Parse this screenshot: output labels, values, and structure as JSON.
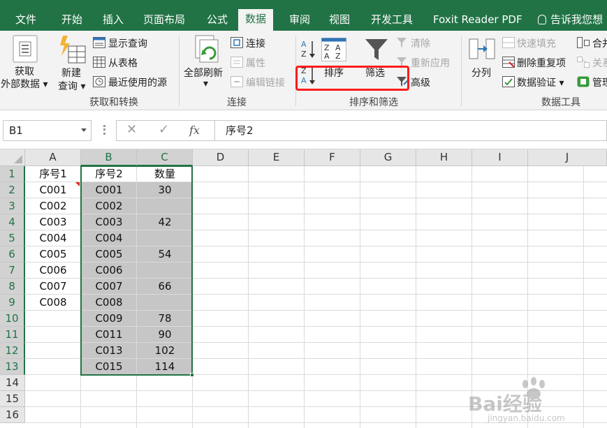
{
  "ribbon_tabs": [
    "文件",
    "开始",
    "插入",
    "页面布局",
    "公式",
    "数据",
    "审阅",
    "视图",
    "开发工具",
    "Foxit Reader PDF"
  ],
  "active_tab": "数据",
  "tell_me": "告诉我您想",
  "groups": {
    "get_transform": {
      "label": "获取和转换",
      "get_external_line1": "获取",
      "get_external_line2": "外部数据",
      "new_query_line1": "新建",
      "new_query_line2": "查询",
      "show_queries": "显示查询",
      "from_table": "从表格",
      "recent_sources": "最近使用的源"
    },
    "connections": {
      "label": "连接",
      "refresh_all": "全部刷新",
      "connections": "连接",
      "properties": "属性",
      "edit_links": "编辑链接"
    },
    "sort_filter": {
      "label": "排序和筛选",
      "sort": "排序",
      "filter": "筛选",
      "clear": "清除",
      "reapply": "重新应用",
      "advanced": "高级"
    },
    "data_tools": {
      "label": "数据工具",
      "text_to_columns": "分列",
      "flash_fill": "快速填充",
      "remove_duplicates": "删除重复项",
      "data_validation": "数据验证",
      "consolidate": "合并",
      "relationships": "关系",
      "manage": "管理"
    }
  },
  "formula_bar": {
    "name_box": "B1",
    "cancel_icon": "✕",
    "enter_icon": "✓",
    "fx": "fx",
    "formula": "序号2"
  },
  "columns": [
    "A",
    "B",
    "C",
    "D",
    "E",
    "F",
    "G",
    "H",
    "I",
    "J"
  ],
  "rows": [
    "1",
    "2",
    "3",
    "4",
    "5",
    "6",
    "7",
    "8",
    "9",
    "10",
    "11",
    "12",
    "13",
    "14",
    "15",
    "16"
  ],
  "cells": {
    "A": [
      "序号1",
      "C001",
      "C002",
      "C003",
      "C004",
      "C005",
      "C006",
      "C007",
      "C008"
    ],
    "B": [
      "序号2",
      "C001",
      "C002",
      "C003",
      "C004",
      "C005",
      "C006",
      "C007",
      "C008",
      "C009",
      "C011",
      "C013",
      "C015"
    ],
    "C": [
      "数量",
      "30",
      "",
      "42",
      "",
      "54",
      "",
      "66",
      "",
      "78",
      "90",
      "102",
      "114"
    ]
  },
  "watermark": {
    "brand": "Bai经验",
    "url": "jingyan.baidu.com"
  },
  "colors": {
    "accent": "#217346",
    "selection_fill": "#c6c6c6",
    "highlight_box": "#ff1a1a"
  }
}
